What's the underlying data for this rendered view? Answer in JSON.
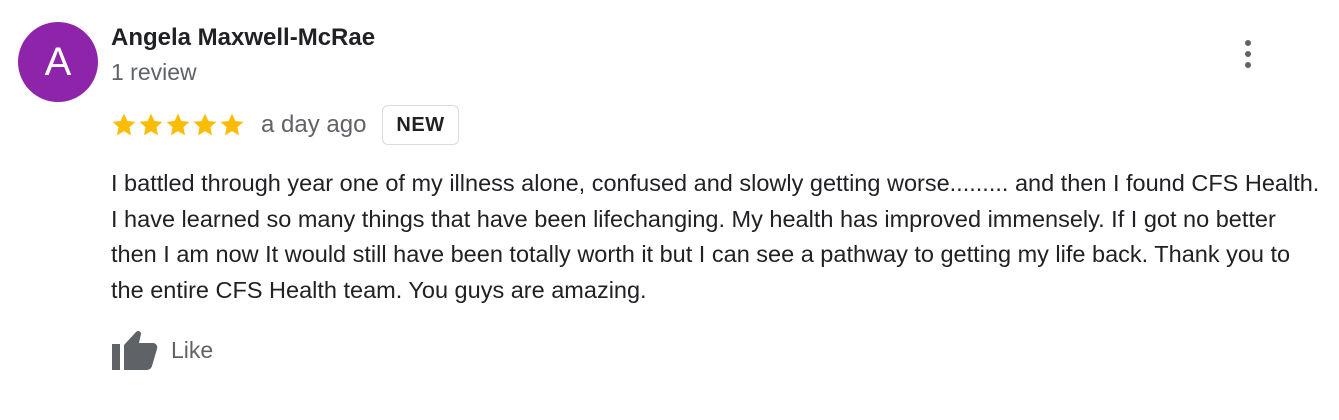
{
  "review": {
    "author": {
      "initial": "A",
      "name": "Angela Maxwell-McRae",
      "review_count": "1 review",
      "avatar_color": "#8e24aa"
    },
    "rating": 5,
    "rating_max": 5,
    "star_color": "#fbbc04",
    "date": "a day ago",
    "badge": "NEW",
    "text": "I battled through year one of my illness alone, confused and slowly getting worse......... and then I found CFS Health.  I have learned so many things that have been lifechanging.  My health has improved immensely. If I got no better then I am now It would still have been totally worth it but I can see a pathway to getting my life back.  Thank you to the entire CFS Health team. You guys are amazing.",
    "like_label": "Like",
    "icons": {
      "menu": "more-vert-icon",
      "star": "star-icon",
      "like": "thumb-up-icon"
    }
  }
}
